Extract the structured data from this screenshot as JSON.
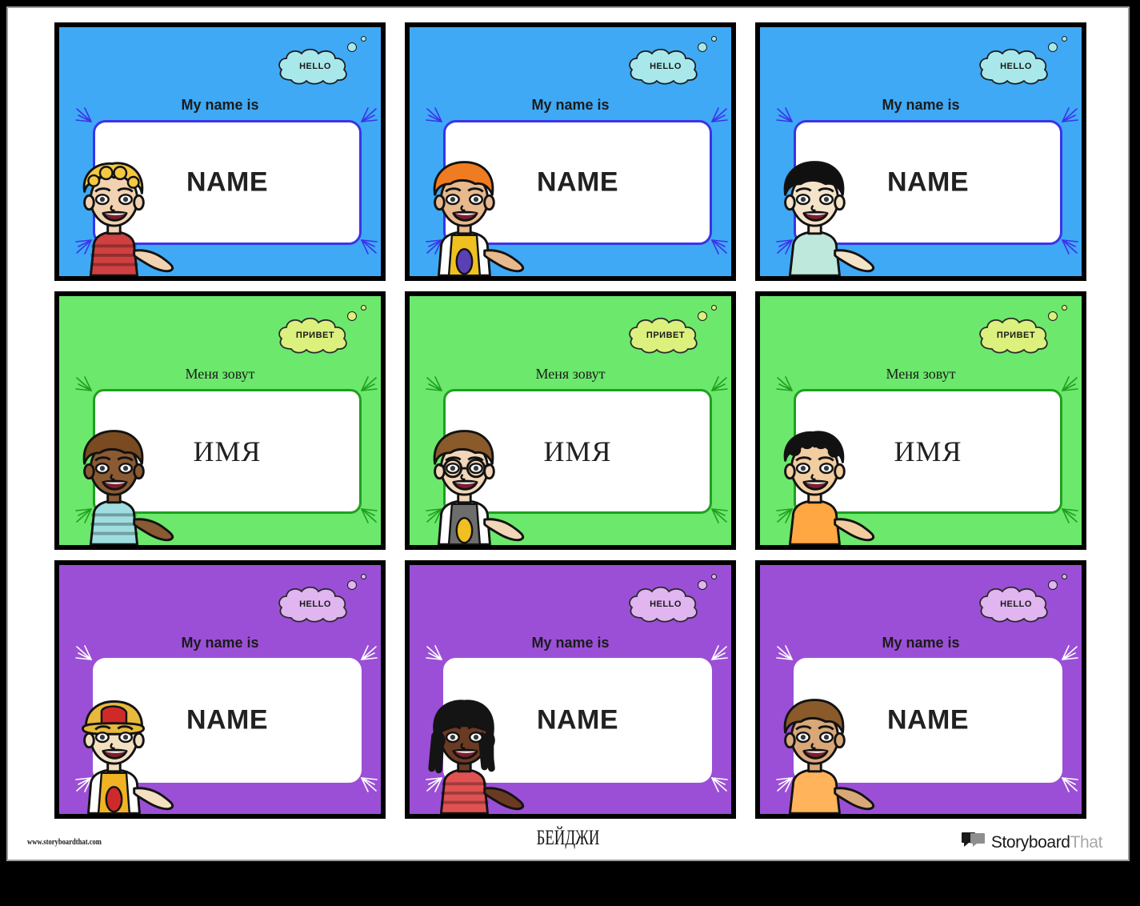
{
  "page": {
    "footer": {
      "site_url": "www.storyboardthat.com",
      "title": "БЕЙДЖИ",
      "logo": {
        "part1": "Storyboard",
        "part2": "That",
        "icon": "speech-bubbles-icon"
      }
    }
  },
  "cards": [
    {
      "id": "card-1",
      "theme": "blue",
      "bg_color": "#3fa9f5",
      "bubble_color": "#a9e8ea",
      "panel_border_color": "#3b34e8",
      "bubble_text": "HELLO",
      "prompt": "My name is",
      "name_value": "NAME",
      "character": {
        "name": "blond-curly-boy",
        "hair": "#f5c842",
        "skin": "#f2d2b0",
        "shirt": "#cf4040",
        "shirt_detail": "stripes"
      }
    },
    {
      "id": "card-2",
      "theme": "blue",
      "bg_color": "#3fa9f5",
      "bubble_color": "#a9e8ea",
      "panel_border_color": "#3b34e8",
      "bubble_text": "HELLO",
      "prompt": "My name is",
      "name_value": "NAME",
      "character": {
        "name": "orange-hair-boy-jersey",
        "hair": "#ef7c20",
        "skin": "#e8b98c",
        "shirt": "#ffffff",
        "shirt_detail": "yellow-jersey"
      }
    },
    {
      "id": "card-3",
      "theme": "blue",
      "bg_color": "#3fa9f5",
      "bubble_color": "#a9e8ea",
      "panel_border_color": "#3b34e8",
      "bubble_text": "HELLO",
      "prompt": "My name is",
      "name_value": "NAME",
      "character": {
        "name": "black-hair-boy",
        "hair": "#101010",
        "skin": "#f4e3c8",
        "shirt": "#bfe8dd",
        "shirt_detail": "plain"
      }
    },
    {
      "id": "card-4",
      "theme": "green",
      "bg_color": "#6ce86c",
      "bubble_color": "#dcf07e",
      "panel_border_color": "#1fa01f",
      "bubble_text": "ПРИВЕТ",
      "prompt": "Меня зовут",
      "name_value": "ИМЯ",
      "character": {
        "name": "brown-skin-boy-striped",
        "hair": "#7a4a20",
        "skin": "#8a5a33",
        "shirt": "#9fdde0",
        "shirt_detail": "stripes"
      }
    },
    {
      "id": "card-5",
      "theme": "green",
      "bg_color": "#6ce86c",
      "bubble_color": "#dcf07e",
      "panel_border_color": "#1fa01f",
      "bubble_text": "ПРИВЕТ",
      "prompt": "Меня зовут",
      "name_value": "ИМЯ",
      "character": {
        "name": "glasses-boy-jersey",
        "hair": "#8a5a2b",
        "skin": "#f2d6b8",
        "shirt": "#ffffff",
        "shirt_detail": "gray-yellow-jersey"
      }
    },
    {
      "id": "card-6",
      "theme": "green",
      "bg_color": "#6ce86c",
      "bubble_color": "#dcf07e",
      "panel_border_color": "#1fa01f",
      "bubble_text": "ПРИВЕТ",
      "prompt": "Меня зовут",
      "name_value": "ИМЯ",
      "character": {
        "name": "curly-black-hair-boy",
        "hair": "#111111",
        "skin": "#f2cda0",
        "shirt": "#ffa843",
        "shirt_detail": "plain"
      }
    },
    {
      "id": "card-7",
      "theme": "purple",
      "bg_color": "#9b4fd6",
      "bubble_color": "#e0b5f0",
      "panel_border_color": "#ffffff",
      "bubble_text": "HELLO",
      "prompt": "My name is",
      "name_value": "NAME",
      "character": {
        "name": "cap-boy-jersey",
        "hair": "#e8b93c",
        "skin": "#f2e0c0",
        "shirt": "#ffffff",
        "shirt_detail": "yellow-red-jersey-cap"
      }
    },
    {
      "id": "card-8",
      "theme": "purple",
      "bg_color": "#9b4fd6",
      "bubble_color": "#e0b5f0",
      "panel_border_color": "#ffffff",
      "bubble_text": "HELLO",
      "prompt": "My name is",
      "name_value": "NAME",
      "character": {
        "name": "dreadlocks-girl",
        "hair": "#141414",
        "skin": "#6b3a22",
        "shirt": "#e05252",
        "shirt_detail": "stripes"
      }
    },
    {
      "id": "card-9",
      "theme": "purple",
      "bg_color": "#9b4fd6",
      "bubble_color": "#e0b5f0",
      "panel_border_color": "#ffffff",
      "bubble_text": "HELLO",
      "prompt": "My name is",
      "name_value": "NAME",
      "character": {
        "name": "brown-hair-boy",
        "hair": "#8a5a2b",
        "skin": "#d9a878",
        "shirt": "#ffb45c",
        "shirt_detail": "plain"
      }
    }
  ]
}
